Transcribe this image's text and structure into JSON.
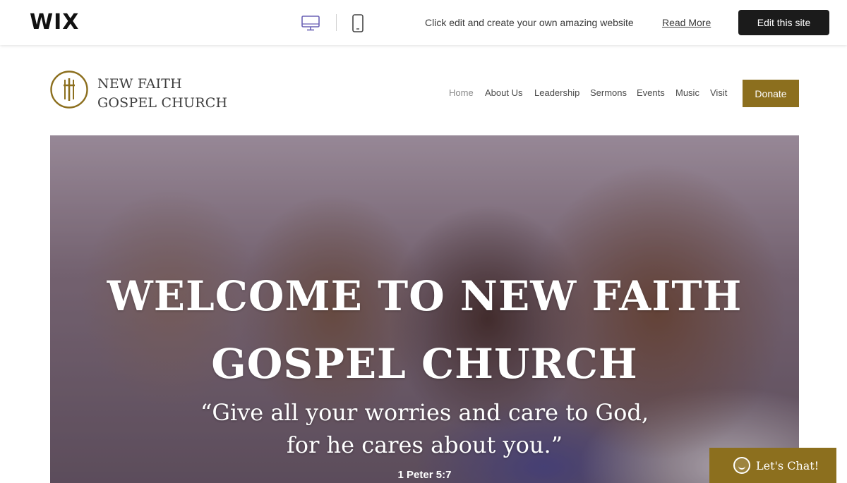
{
  "wix_bar": {
    "logo": "WIX",
    "desktop_view_icon": "desktop-monitor-icon",
    "mobile_view_icon": "mobile-phone-icon",
    "promo_text": "Click edit and create your own amazing website",
    "read_more": "Read More",
    "edit_button": "Edit this site"
  },
  "site": {
    "logo_icon": "cross-emblem-icon",
    "name_line1": "NEW FAITH",
    "name_line2": "GOSPEL CHURCH",
    "nav": [
      {
        "label": "Home",
        "active": true
      },
      {
        "label": "About Us"
      },
      {
        "label": "Leadership"
      },
      {
        "label": "Sermons"
      },
      {
        "label": "Events"
      },
      {
        "label": "Music"
      },
      {
        "label": "Visit"
      }
    ],
    "donate_button": "Donate"
  },
  "hero": {
    "title_line1": "WELCOME TO NEW FAITH",
    "title_line2": "GOSPEL CHURCH",
    "quote_line1": "“Give all your worries and care to God,",
    "quote_line2": "for he cares about you.”",
    "reference": "1 Peter 5:7"
  },
  "chat": {
    "icon": "smiley-chat-icon",
    "label": "Let's Chat!"
  },
  "colors": {
    "accent_gold": "#8c6f1e",
    "wix_button": "#1b1b1b",
    "desktop_icon": "#6b62b5"
  }
}
